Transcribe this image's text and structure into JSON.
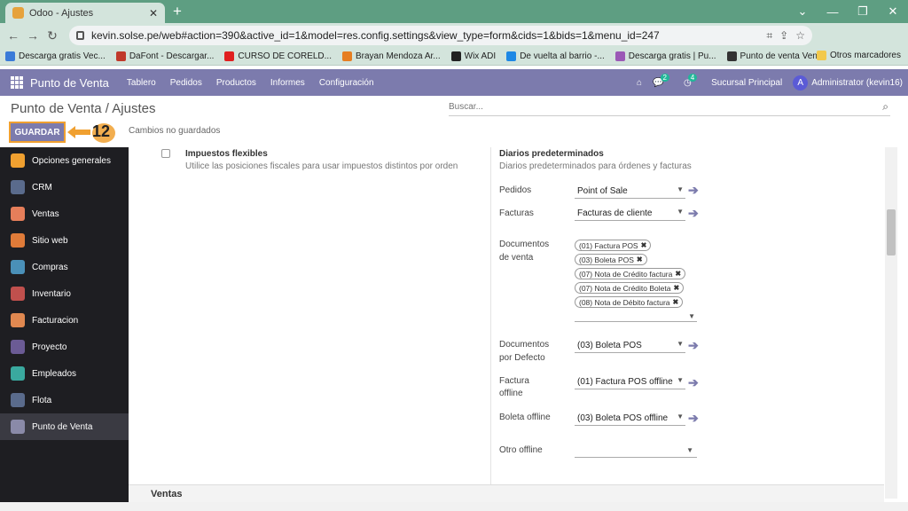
{
  "browser": {
    "tab_title": "Odoo - Ajustes",
    "url": "kevin.solse.pe/web#action=390&active_id=1&model=res.config.settings&view_type=form&cids=1&bids=1&menu_id=247",
    "profile_initial": "K",
    "bookmarks": [
      {
        "label": "Descarga gratis Vec...",
        "color": "#3b7bd8"
      },
      {
        "label": "DaFont - Descargar...",
        "color": "#c0392b"
      },
      {
        "label": "CURSO DE CORELD...",
        "color": "#e02020"
      },
      {
        "label": "Brayan Mendoza Ar...",
        "color": "#e67e22"
      },
      {
        "label": "Wix ADI",
        "color": "#222222"
      },
      {
        "label": "De vuelta al barrio -...",
        "color": "#1e88e5"
      },
      {
        "label": "Descarga gratis | Pu...",
        "color": "#9b59b6"
      },
      {
        "label": "Punto de venta Ven...",
        "color": "#333333"
      }
    ],
    "other_bookmarks": "Otros marcadores"
  },
  "odoo_nav": {
    "brand": "Punto de Venta",
    "menu": [
      "Tablero",
      "Pedidos",
      "Productos",
      "Informes",
      "Configuración"
    ],
    "messages_count": "2",
    "activities_count": "4",
    "company": "Sucursal Principal",
    "user_initial": "A",
    "user": "Administrator (kevin16)"
  },
  "control": {
    "breadcrumb": "Punto de Venta / Ajustes",
    "search_placeholder": "Buscar...",
    "save_label": "GUARDAR",
    "step_number": "12",
    "unsaved_label": "Cambios no guardados"
  },
  "sidebar": {
    "items": [
      {
        "label": "Opciones generales",
        "color": "#f0a030"
      },
      {
        "label": "CRM",
        "color": "#5a6b8c"
      },
      {
        "label": "Ventas",
        "color": "#e67e5a"
      },
      {
        "label": "Sitio web",
        "color": "#e07b39"
      },
      {
        "label": "Compras",
        "color": "#4a90b8"
      },
      {
        "label": "Inventario",
        "color": "#c0504d"
      },
      {
        "label": "Facturacion",
        "color": "#e08850"
      },
      {
        "label": "Proyecto",
        "color": "#6b5b95"
      },
      {
        "label": "Empleados",
        "color": "#3aa99f"
      },
      {
        "label": "Flota",
        "color": "#5a6b8c"
      },
      {
        "label": "Punto de Venta",
        "color": "#8a8aa8"
      }
    ],
    "active_index": 10
  },
  "settings": {
    "flex_tax_title": "Impuestos flexibles",
    "flex_tax_desc": "Utilice las posiciones fiscales para usar impuestos distintos por orden",
    "journals_title": "Diarios predeterminados",
    "journals_desc": "Diarios predeterminados para órdenes y facturas",
    "orders_label": "Pedidos",
    "orders_value": "Point of Sale",
    "invoices_label": "Facturas",
    "invoices_value": "Facturas de cliente",
    "sale_docs_label_1": "Documentos",
    "sale_docs_label_2": "de venta",
    "sale_docs": [
      "(01) Factura POS",
      "(03) Boleta POS",
      "(07) Nota de Crédito factura",
      "(07) Nota de Crédito Boleta",
      "(08) Nota de Débito factura"
    ],
    "default_docs_label_1": "Documentos",
    "default_docs_label_2": "por Defecto",
    "default_docs_value": "(03) Boleta POS",
    "offline_invoice_label_1": "Factura",
    "offline_invoice_label_2": "offline",
    "offline_invoice_value": "(01) Factura POS offline",
    "offline_receipt_label": "Boleta offline",
    "offline_receipt_value": "(03) Boleta POS offline",
    "other_offline_label": "Otro offline",
    "other_offline_value": "",
    "section_title": "Ventas"
  }
}
